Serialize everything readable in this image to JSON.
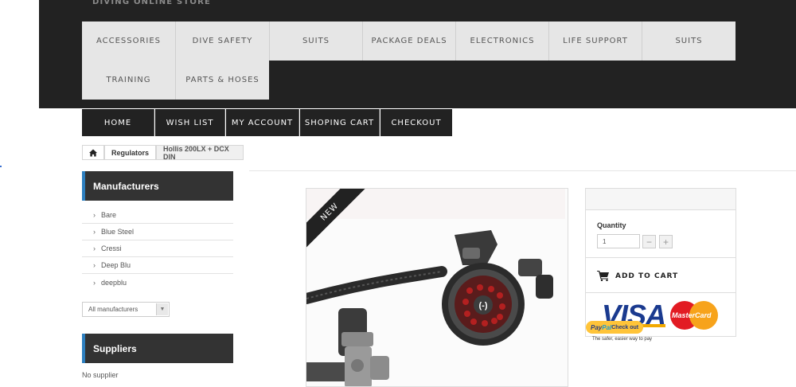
{
  "header": {
    "store_name": "DIVING ONLINE STORE",
    "categories": [
      "ACCESSORIES",
      "DIVE SAFETY",
      "SUITS",
      "PACKAGE DEALS",
      "ELECTRONICS",
      "LIFE SUPPORT",
      "SUITS",
      "TRAINING",
      "PARTS & HOSES"
    ]
  },
  "nav": {
    "items": [
      "HOME",
      "WISH LIST",
      "MY ACCOUNT",
      "SHOPING CART",
      "CHECKOUT"
    ]
  },
  "breadcrumb": {
    "home_icon": "home-icon",
    "items": [
      "Regulators",
      "Hollis 200LX + DCX DIN"
    ]
  },
  "sidebar": {
    "manufacturers_title": "Manufacturers",
    "manufacturers": [
      "Bare",
      "Blue Steel",
      "Cressi",
      "Deep Blu",
      "deepblu"
    ],
    "manufacturers_select": "All manufacturers",
    "suppliers_title": "Suppliers",
    "suppliers_text": "No supplier"
  },
  "product": {
    "badge": "NEW",
    "quantity_label": "Quantity",
    "quantity_value": "1",
    "minus": "−",
    "plus": "+",
    "add_to_cart": "ADD TO CART",
    "payment": {
      "visa": "VISA",
      "mastercard": "MasterCard",
      "paypal_a": "Pay",
      "paypal_b": "Pal",
      "paypal_c": " Check out",
      "paypal_tagline": "The safer, easier way to pay"
    }
  },
  "colors": {
    "header_bg": "#222222",
    "accent": "#2d7fbf",
    "category_bg": "#e6e6e6"
  }
}
